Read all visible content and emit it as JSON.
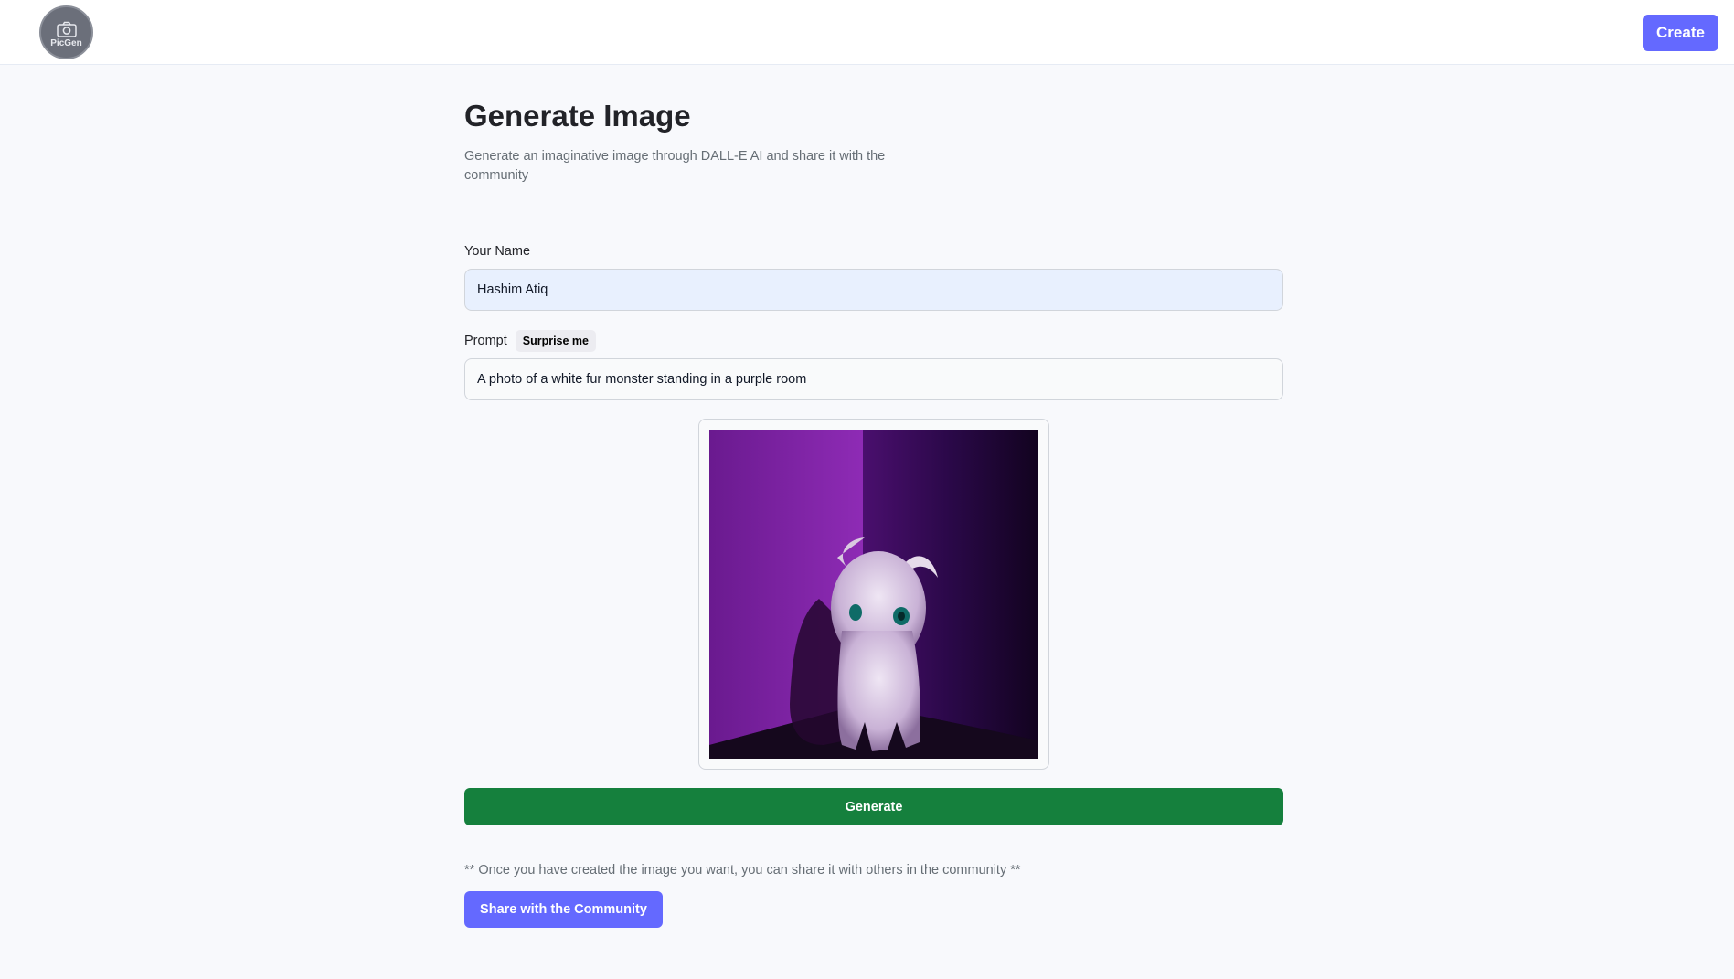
{
  "header": {
    "logo_text": "PicGen",
    "logo_icon": "camera-icon",
    "create_label": "Create"
  },
  "page": {
    "title": "Generate Image",
    "subtitle": "Generate an imaginative image through DALL-E AI and share it with the community"
  },
  "form": {
    "name_label": "Your Name",
    "name_value": "Hashim Atiq",
    "prompt_label": "Prompt",
    "surprise_label": "Surprise me",
    "prompt_value": "A photo of a white fur monster standing in a purple room"
  },
  "preview": {
    "alt": "A photo of a white fur monster standing in a purple room"
  },
  "actions": {
    "generate_label": "Generate",
    "share_note": "** Once you have created the image you want, you can share it with others in the community **",
    "share_label": "Share with the Community"
  },
  "colors": {
    "primary": "#6469ff",
    "generate": "#15803d",
    "background": "#f8f9fc"
  }
}
